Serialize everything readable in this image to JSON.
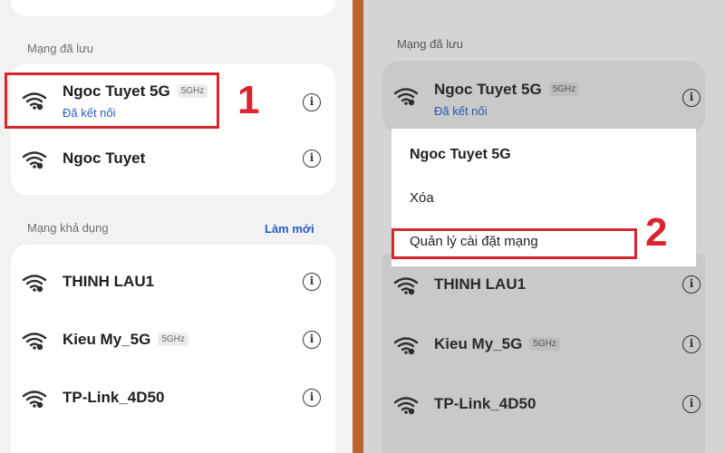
{
  "left": {
    "saved_label": "Mạng đã lưu",
    "saved": [
      {
        "name": "Ngoc Tuyet 5G",
        "badge": "5GHz",
        "status": "Đã kết nối"
      },
      {
        "name": "Ngoc Tuyet"
      }
    ],
    "available_label": "Mạng khả dụng",
    "refresh_label": "Làm mới",
    "available": [
      {
        "name": "THINH LAU1"
      },
      {
        "name": "Kieu My_5G",
        "badge": "5GHz"
      },
      {
        "name": "TP-Link_4D50"
      }
    ],
    "step_number": "1"
  },
  "right": {
    "saved_label": "Mạng đã lưu",
    "saved": [
      {
        "name": "Ngoc Tuyet 5G",
        "badge": "5GHz",
        "status": "Đã kết nối"
      }
    ],
    "menu": {
      "title": "Ngoc Tuyet 5G",
      "items": [
        "Xóa",
        "Quản lý cài đặt mạng"
      ]
    },
    "available": [
      {
        "name": "THINH LAU1"
      },
      {
        "name": "Kieu My_5G",
        "badge": "5GHz"
      },
      {
        "name": "TP-Link_4D50"
      }
    ],
    "step_number": "2"
  },
  "icons": {
    "wifi": "wifi-lock-icon",
    "info": "info-icon",
    "info_glyph": "i"
  },
  "colors": {
    "annotation_red": "#d9252f",
    "link_blue": "#2b5cc4",
    "divider": "#b9642b"
  }
}
